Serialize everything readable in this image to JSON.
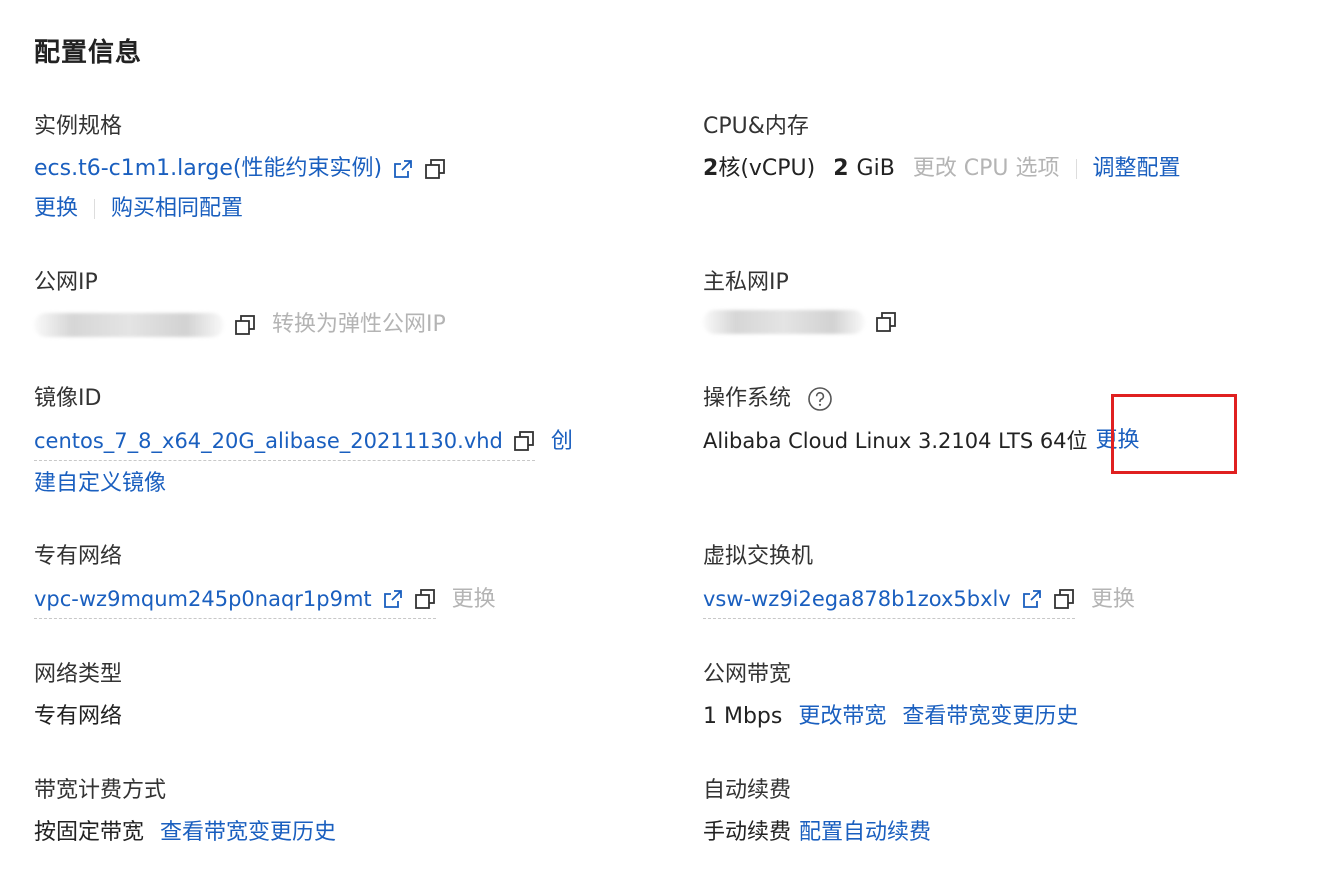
{
  "page_title": "配置信息",
  "instance_spec": {
    "label": "实例规格",
    "value": "ecs.t6-c1m1.large(性能约束实例)",
    "change_link": "更换",
    "buy_same_link": "购买相同配置"
  },
  "cpu_memory": {
    "label": "CPU&内存",
    "cpu_number": "2",
    "cpu_unit": "核(vCPU)",
    "memory_number": "2",
    "memory_unit": "GiB",
    "change_cpu_option": "更改 CPU 选项",
    "adjust_config_link": "调整配置"
  },
  "public_ip": {
    "label": "公网IP",
    "convert_link": "转换为弹性公网IP"
  },
  "private_ip": {
    "label": "主私网IP"
  },
  "image_id": {
    "label": "镜像ID",
    "value": "centos_7_8_x64_20G_alibase_20211130.vhd",
    "create_custom_part1": "创",
    "create_custom_part2": "建自定义镜像"
  },
  "os": {
    "label": "操作系统",
    "value": "Alibaba Cloud Linux 3.2104 LTS 64位",
    "change_link": "更换"
  },
  "vpc": {
    "label": "专有网络",
    "value": "vpc-wz9mqum245p0naqr1p9mt",
    "change_link": "更换"
  },
  "vswitch": {
    "label": "虚拟交换机",
    "value": "vsw-wz9i2ega878b1zox5bxlv",
    "change_link": "更换"
  },
  "network_type": {
    "label": "网络类型",
    "value": "专有网络"
  },
  "public_bandwidth": {
    "label": "公网带宽",
    "value": "1 Mbps",
    "change_link": "更改带宽",
    "history_link": "查看带宽变更历史"
  },
  "billing_method": {
    "label": "带宽计费方式",
    "value": "按固定带宽",
    "history_link": "查看带宽变更历史"
  },
  "auto_renew": {
    "label": "自动续费",
    "value": "手动续费",
    "config_link": "配置自动续费"
  },
  "colors": {
    "link": "#1a5fbf",
    "muted": "#b4b4b4",
    "highlight": "#e02020"
  }
}
